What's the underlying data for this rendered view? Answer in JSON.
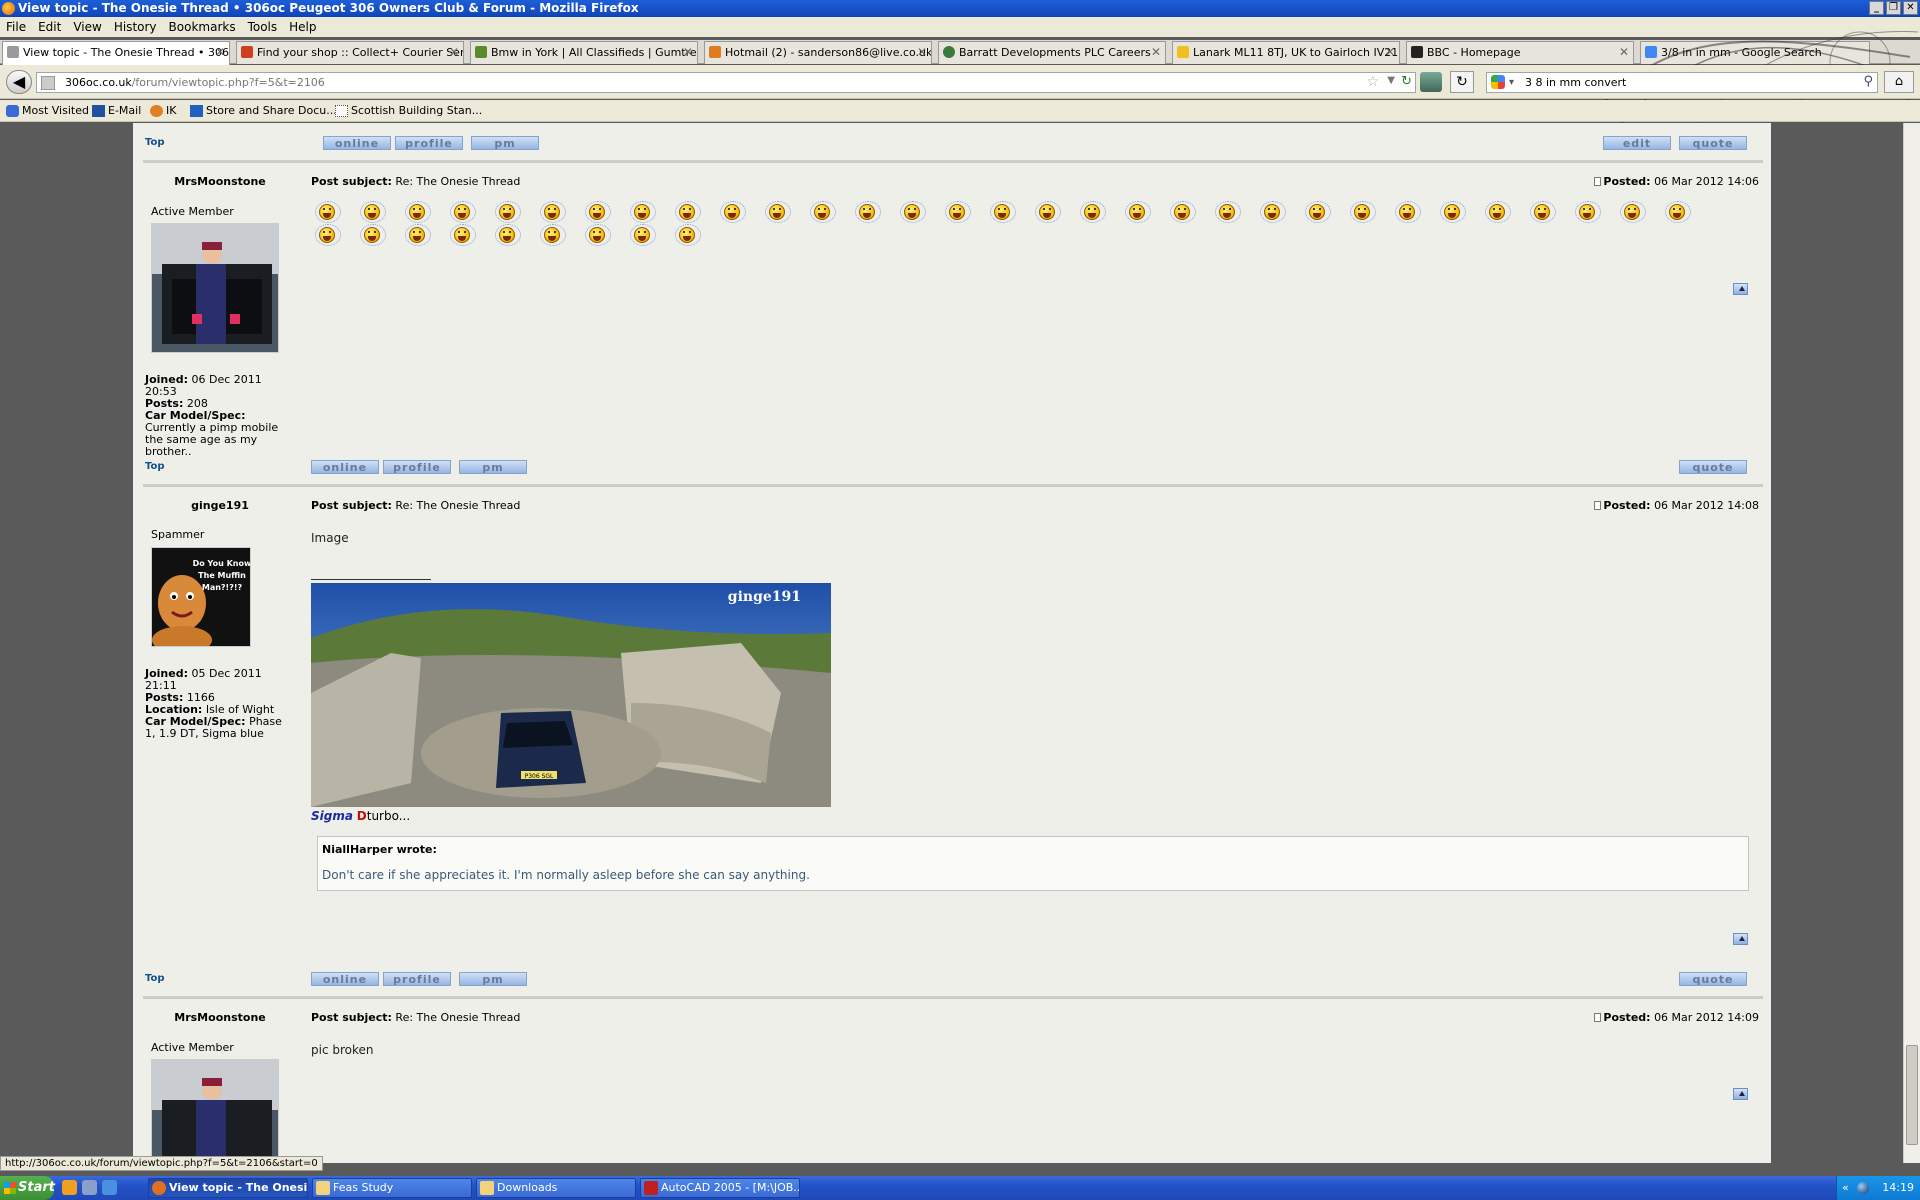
{
  "window": {
    "title": "View topic - The Onesie Thread • 306oc Peugeot 306 Owners Club & Forum - Mozilla Firefox",
    "controls": [
      "_",
      "❐",
      "✕"
    ]
  },
  "menu": [
    "File",
    "Edit",
    "View",
    "History",
    "Bookmarks",
    "Tools",
    "Help"
  ],
  "tabs": [
    {
      "label": "View topic - The Onesie Thread • 306...",
      "icon_color": "#9a9a9a",
      "active": true
    },
    {
      "label": "Find your shop :: Collect+ Courier Ser...",
      "icon_color": "#d04020"
    },
    {
      "label": "Bmw in York | All Classifieds | Gumtree...",
      "icon_color": "#5a8a2a"
    },
    {
      "label": "Hotmail (2) - sanderson86@live.co.uk...",
      "icon_color": "#e07b20"
    },
    {
      "label": "Barratt Developments PLC Careers",
      "icon_color": "#3a7a3a"
    },
    {
      "label": "Lanark ML11 8TJ, UK to Gairloch IV21 ...",
      "icon_color": "#f0c020"
    },
    {
      "label": "BBC - Homepage",
      "icon_color": "#222222"
    },
    {
      "label": "3/8 in in mm - Google Search",
      "icon_color": "#4285f4"
    }
  ],
  "nav": {
    "url_host": "306oc.co.uk",
    "url_path": "/forum/viewtopic.php?f=5&t=2106",
    "search_query": "3 8 in mm convert"
  },
  "bookmarks": [
    {
      "label": "Most Visited",
      "icon_color": "#3a6ad4"
    },
    {
      "label": "E-Mail",
      "icon_color": "#2050a0"
    },
    {
      "label": "IK",
      "icon_color": "#e08020"
    },
    {
      "label": "Store and Share Docu...",
      "icon_color": "#2060c0"
    },
    {
      "label": "Scottish Building Stan...",
      "icon_color": "#ffffff"
    }
  ],
  "forum": {
    "top_label": "Top",
    "buttons": {
      "online": "online",
      "profile": "profile",
      "pm": "pm",
      "edit": "edit",
      "quote": "quote"
    },
    "posts": [
      {
        "author": "MrsMoonstone",
        "rank": "Active Member",
        "joined_label": "Joined:",
        "joined": "06 Dec 2011 20:53",
        "posts_label": "Posts:",
        "posts": "208",
        "car_label": "Car Model/Spec:",
        "car": "Currently a pimp mobile the same age as my brother..",
        "subject_label": "Post subject:",
        "subject": "Re: The Onesie Thread",
        "posted_label": "Posted:",
        "posted": "06 Mar 2012 14:06",
        "smiley_count": 40
      },
      {
        "author": "ginge191",
        "rank": "Spammer",
        "avatar_text": "Do You Know The Muffin Man?!?!?",
        "joined_label": "Joined:",
        "joined": "05 Dec 2011 21:11",
        "posts_label": "Posts:",
        "posts": "1166",
        "location_label": "Location:",
        "location": "Isle of Wight",
        "car_label": "Car Model/Spec:",
        "car": "Phase 1, 1.9 DT, Sigma blue",
        "subject_label": "Post subject:",
        "subject": "Re: The Onesie Thread",
        "posted_label": "Posted:",
        "posted": "06 Mar 2012 14:08",
        "body": "Image",
        "sig_watermark": "ginge191",
        "sig_plate": "P306 SGL",
        "sig_sigma": "Sigma",
        "sig_d": "D",
        "sig_rest": "turbo...",
        "quote_author": "NiallHarper wrote:",
        "quote_text": "Don't care if she appreciates it. I'm normally asleep before she can say anything."
      },
      {
        "author": "MrsMoonstone",
        "rank": "Active Member",
        "subject_label": "Post subject:",
        "subject": "Re: The Onesie Thread",
        "posted_label": "Posted:",
        "posted": "06 Mar 2012 14:09",
        "body": "pic broken"
      }
    ]
  },
  "statusbar": "http://306oc.co.uk/forum/viewtopic.php?f=5&t=2106&start=0",
  "taskbar": {
    "start": "Start",
    "tasks": [
      {
        "label": "View topic - The Onesi...",
        "icon_color": "#e07020",
        "active": true
      },
      {
        "label": "Feas Study",
        "icon_color": "#f2d27a"
      },
      {
        "label": "Downloads",
        "icon_color": "#f2d27a"
      },
      {
        "label": "AutoCAD 2005 - [M:\\JOB...",
        "icon_color": "#c02020"
      }
    ],
    "clock": "14:19",
    "tray_chevron": "«"
  }
}
